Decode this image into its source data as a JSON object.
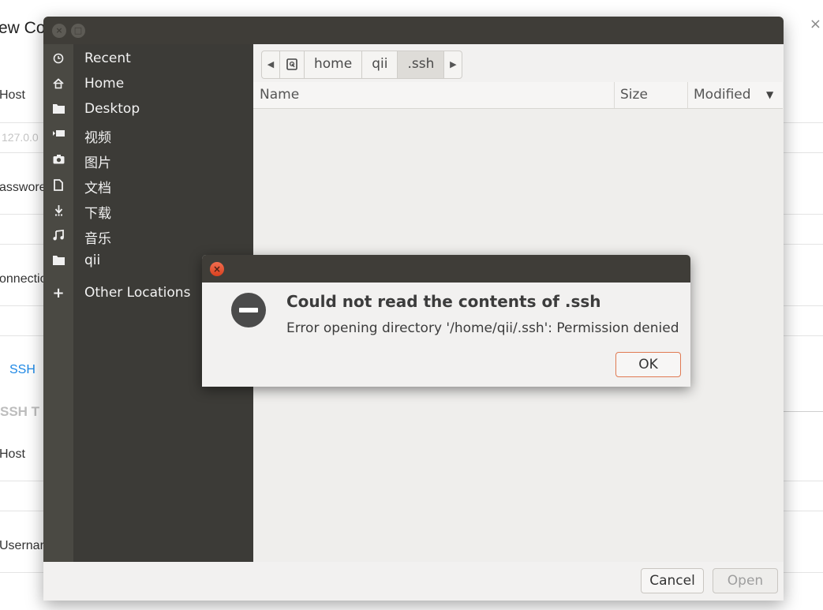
{
  "background_app": {
    "title": "ew Co",
    "close": "×",
    "labels": {
      "host": "Host",
      "host_placeholder": "127.0.0",
      "password": "asswore",
      "connection": "onnectio",
      "ssh_tab": "SSH",
      "section": "SSH T",
      "ssh_host": "Host",
      "username": "Usernar"
    }
  },
  "file_chooser": {
    "titlebar_buttons": {
      "close": "×",
      "maximize": "□"
    },
    "sidebar": {
      "items": [
        {
          "label": "Recent",
          "icon": "clock-icon"
        },
        {
          "label": "Home",
          "icon": "home-icon"
        },
        {
          "label": "Desktop",
          "icon": "folder-icon"
        },
        {
          "label": "视频",
          "icon": "video-icon"
        },
        {
          "label": "图片",
          "icon": "camera-icon"
        },
        {
          "label": "文档",
          "icon": "document-icon"
        },
        {
          "label": "下载",
          "icon": "download-icon"
        },
        {
          "label": "音乐",
          "icon": "music-icon"
        },
        {
          "label": "qii",
          "icon": "folder-icon"
        }
      ],
      "other_locations": {
        "label": "Other Locations",
        "icon": "plus-icon"
      }
    },
    "pathbar": {
      "back": "◀",
      "segments": [
        "home",
        "qii",
        ".ssh"
      ],
      "forward": "▶"
    },
    "columns": {
      "name": "Name",
      "size": "Size",
      "modified": "Modified"
    },
    "buttons": {
      "cancel": "Cancel",
      "open": "Open"
    }
  },
  "error_dialog": {
    "heading": "Could not read the contents of .ssh",
    "message": "Error opening directory '/home/qii/.ssh': Permission denied",
    "ok_label": "OK",
    "close": "×",
    "icon": "error-icon"
  },
  "colors": {
    "titlebar": "#3f3d38",
    "sidebar": "#3c3b37",
    "accent": "#e07a52",
    "link": "#1e88e5"
  }
}
